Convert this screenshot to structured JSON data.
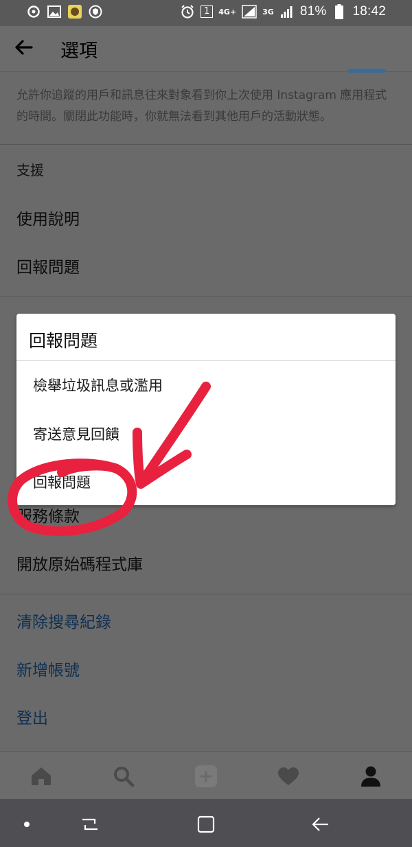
{
  "status": {
    "battery": "81%",
    "time": "18:42",
    "network_a": "4G+",
    "network_b": "3G",
    "sim": "1"
  },
  "appbar": {
    "title": "選項"
  },
  "activity": {
    "description": "允許你追蹤的用戶和訊息往來對象看到你上次使用 Instagram 應用程式的時間。關閉此功能時，你就無法看到其他用戶的活動狀態。"
  },
  "support": {
    "heading": "支援",
    "items": [
      "使用說明",
      "回報問題"
    ]
  },
  "about": {
    "items": [
      "服務條款",
      "開放原始碼程式庫"
    ]
  },
  "actions": {
    "items": [
      "清除搜尋紀錄",
      "新增帳號",
      "登出"
    ]
  },
  "dialog": {
    "title": "回報問題",
    "options": [
      "檢舉垃圾訊息或濫用",
      "寄送意見回饋",
      "回報問題"
    ]
  },
  "tabs": [
    "home-icon",
    "search-icon",
    "add-icon",
    "heart-icon",
    "profile-icon"
  ],
  "colors": {
    "link": "#0f2f52",
    "annotation": "#e8213f",
    "dim_overlay": "#6a6a6a"
  }
}
